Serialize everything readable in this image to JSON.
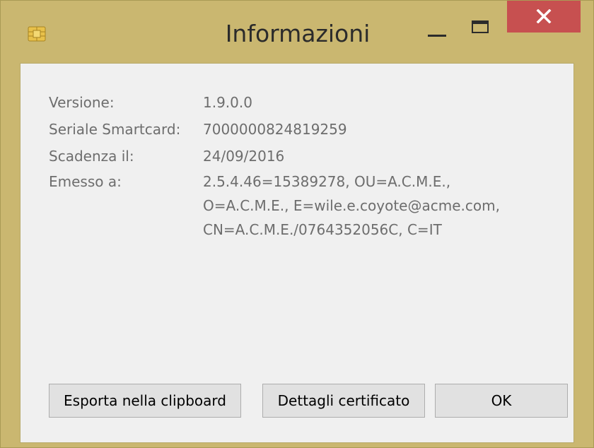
{
  "window": {
    "title": "Informazioni",
    "icon": "smartcard-chip-icon",
    "controls": {
      "minimize": "minimize-icon",
      "maximize": "maximize-icon",
      "close": "close-icon",
      "close_color": "#c75050"
    }
  },
  "info": {
    "version": {
      "label": "Versione:",
      "value": "1.9.0.0"
    },
    "serial": {
      "label": "Seriale Smartcard:",
      "value": "7000000824819259"
    },
    "expiry": {
      "label": "Scadenza il:",
      "value": "24/09/2016"
    },
    "issued_to": {
      "label": "Emesso a:",
      "lines": [
        "2.5.4.46=15389278, OU=A.C.M.E.,",
        "O=A.C.M.E., E=wile.e.coyote@acme.com,",
        "CN=A.C.M.E./0764352056C, C=IT"
      ]
    }
  },
  "buttons": {
    "export": "Esporta nella clipboard",
    "details": "Dettagli certificato",
    "ok": "OK"
  },
  "colors": {
    "frame": "#cab770",
    "client_bg": "#f0f0f0",
    "text_disabled": "#6d6d6d"
  }
}
